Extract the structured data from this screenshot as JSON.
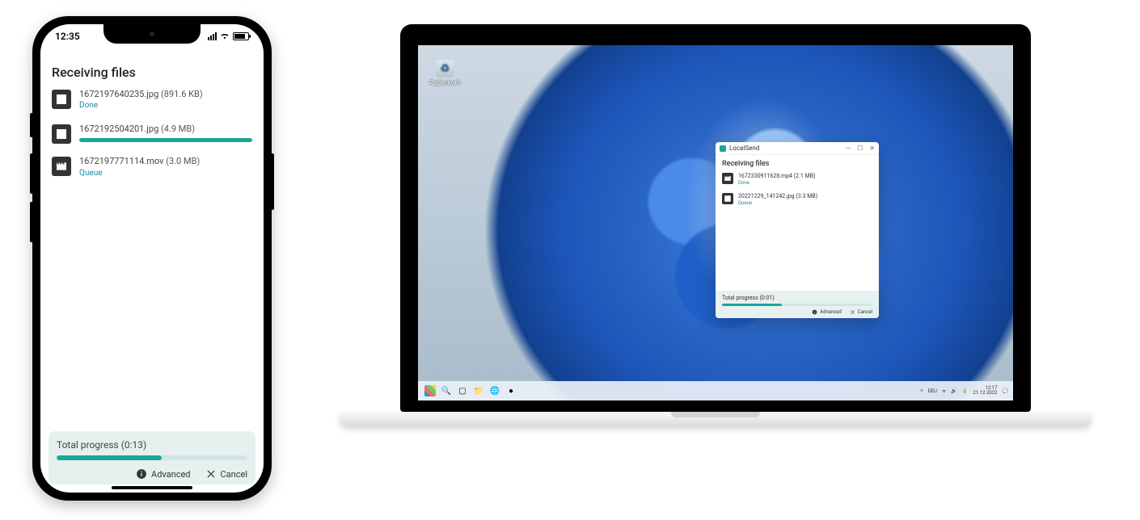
{
  "colors": {
    "accent": "#1aa69c",
    "status_link": "#1a8f9d"
  },
  "phone": {
    "status_time": "12:35",
    "heading": "Receiving files",
    "files": [
      {
        "icon": "image",
        "name": "1672197640235.jpg",
        "size": "891.6 KB",
        "status": "Done",
        "progress": null
      },
      {
        "icon": "image",
        "name": "1672192504201.jpg",
        "size": "4.9 MB",
        "status": "",
        "progress": 100
      },
      {
        "icon": "movie",
        "name": "1672197771114.mov",
        "size": "3.0 MB",
        "status": "Queue",
        "progress": null
      }
    ],
    "total_progress_label": "Total progress (0:13)",
    "total_progress_percent": 55,
    "advanced_label": "Advanced",
    "cancel_label": "Cancel"
  },
  "laptop": {
    "recycle_label": "Papierkorb",
    "window": {
      "title": "LocalSend",
      "heading": "Receiving files",
      "files": [
        {
          "icon": "movie",
          "name": "1672330911628.mp4",
          "size": "2.1 MB",
          "status": "Done"
        },
        {
          "icon": "image",
          "name": "20221229_141242.jpg",
          "size": "3.3 MB",
          "status": "Queue"
        }
      ],
      "total_progress_label": "Total progress (0:01)",
      "total_progress_percent": 40,
      "advanced_label": "Advanced",
      "cancel_label": "Cancel"
    },
    "taskbar": {
      "tray_lang": "DEU",
      "clock_time": "12:17",
      "clock_date": "21.12.2022"
    }
  }
}
